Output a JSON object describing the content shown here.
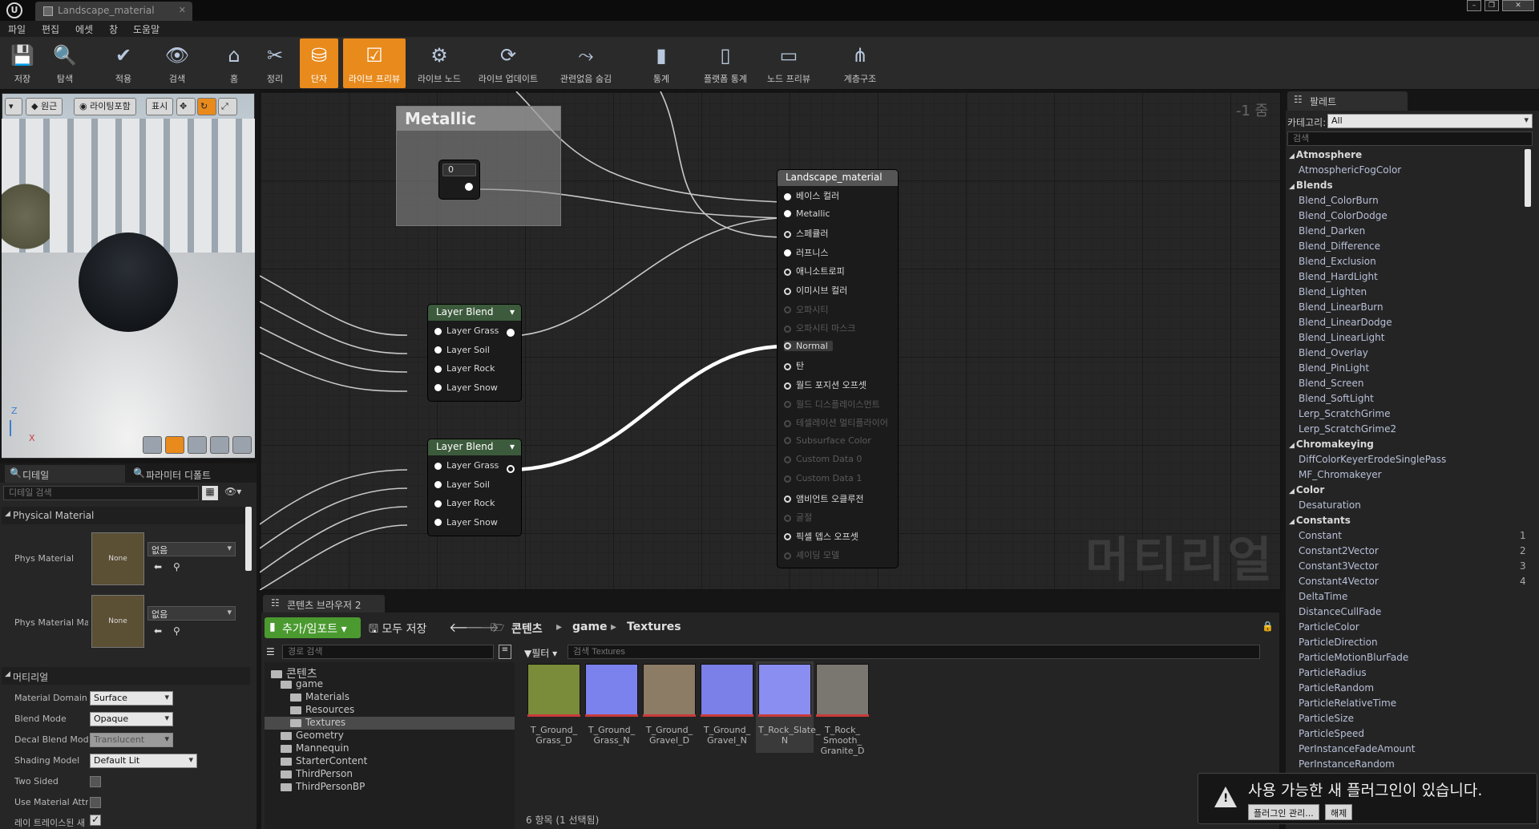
{
  "window": {
    "tab_title": "Landscape_material",
    "logo": "U"
  },
  "menu": [
    "파일",
    "편집",
    "에셋",
    "창",
    "도움말"
  ],
  "toolbar": [
    {
      "label": "저장",
      "icon": "💾"
    },
    {
      "label": "탐색",
      "icon": "🔍"
    },
    {
      "label": "적용",
      "icon": "✔"
    },
    {
      "label": "검색",
      "icon": "👁"
    },
    {
      "label": "홈",
      "icon": "⌂"
    },
    {
      "label": "정리",
      "icon": "✂"
    },
    {
      "label": "단자",
      "icon": "⛁"
    },
    {
      "label": "라이브 프리뷰",
      "icon": "☑"
    },
    {
      "label": "라이브 노드",
      "icon": "⚙"
    },
    {
      "label": "라이브 업데이트",
      "icon": "⟳"
    },
    {
      "label": "관련없음 숨김",
      "icon": "⤳"
    },
    {
      "label": "통계",
      "icon": "▮"
    },
    {
      "label": "플랫폼 통계",
      "icon": "▯"
    },
    {
      "label": "노드 프리뷰",
      "icon": "▭"
    },
    {
      "label": "계층구조",
      "icon": "⋔"
    }
  ],
  "viewport": {
    "btn_origin": "원근",
    "btn_lit": "라이팅포함",
    "btn_show": "표시",
    "axis_z": "Z",
    "axis_x": "X"
  },
  "details": {
    "tab1": "디테일",
    "tab2": "파라미터 디폴트",
    "search_placeholder": "디테일 검색",
    "section_physical": "Physical Material",
    "phys_material_label": "Phys Material",
    "phys_material_mask_label": "Phys Material Ma",
    "none": "None",
    "none_combo": "없음",
    "section_material": "머티리얼",
    "props": [
      {
        "label": "Material Domain",
        "value": "Surface"
      },
      {
        "label": "Blend Mode",
        "value": "Opaque"
      },
      {
        "label": "Decal Blend Mode",
        "value": "Translucent"
      },
      {
        "label": "Shading Model",
        "value": "Default Lit"
      }
    ],
    "two_sided": "Two Sided",
    "use_material_attr": "Use Material Attri",
    "ray_tracing": "레이 트레이스된 새"
  },
  "graph": {
    "zoom": "-1 줌",
    "watermark": "머티리얼",
    "metallic_node": {
      "title": "Metallic",
      "value": "0"
    },
    "layer_blend_1": {
      "title": "Layer Blend",
      "pins": [
        "Layer Grass",
        "Layer Soil",
        "Layer Rock",
        "Layer Snow"
      ]
    },
    "layer_blend_2": {
      "title": "Layer Blend",
      "pins": [
        "Layer Grass",
        "Layer Soil",
        "Layer Rock",
        "Layer Snow"
      ]
    },
    "material_node": {
      "title": "Landscape_material",
      "pins": [
        {
          "label": "베이스 컬러",
          "active": true
        },
        {
          "label": "Metallic",
          "active": true
        },
        {
          "label": "스페큘러",
          "active": true
        },
        {
          "label": "러프니스",
          "active": true
        },
        {
          "label": "애니소트로피",
          "active": true
        },
        {
          "label": "이미시브 컬러",
          "active": true
        },
        {
          "label": "오파시티",
          "active": false
        },
        {
          "label": "오파시티 마스크",
          "active": false
        },
        {
          "label": "Normal",
          "active": true
        },
        {
          "label": "탄",
          "active": true
        },
        {
          "label": "월드 포지션 오프셋",
          "active": true
        },
        {
          "label": "월드 디스플레이스먼트",
          "active": false
        },
        {
          "label": "테셀레이션 멀티플라이어",
          "active": false
        },
        {
          "label": "Subsurface Color",
          "active": false
        },
        {
          "label": "Custom Data 0",
          "active": false
        },
        {
          "label": "Custom Data 1",
          "active": false
        },
        {
          "label": "앰비언트 오클루전",
          "active": true
        },
        {
          "label": "굴절",
          "active": false
        },
        {
          "label": "픽셀 뎁스 오프셋",
          "active": true
        },
        {
          "label": "셰이딩 모델",
          "active": false
        }
      ]
    }
  },
  "content_browser": {
    "tab": "콘텐츠 브라우저 2",
    "add_import": "추가/임포트",
    "save_all": "모두 저장",
    "crumbs": [
      "콘텐츠",
      "game",
      "Textures"
    ],
    "path_search_placeholder": "경로 검색",
    "filter": "필터",
    "search_placeholder": "검색 Textures",
    "tree": [
      {
        "label": "콘텐츠",
        "indent": 0
      },
      {
        "label": "game",
        "indent": 1
      },
      {
        "label": "Materials",
        "indent": 2
      },
      {
        "label": "Resources",
        "indent": 2
      },
      {
        "label": "Textures",
        "indent": 2
      },
      {
        "label": "Geometry",
        "indent": 1
      },
      {
        "label": "Mannequin",
        "indent": 1
      },
      {
        "label": "StarterContent",
        "indent": 1
      },
      {
        "label": "ThirdPerson",
        "indent": 1
      },
      {
        "label": "ThirdPersonBP",
        "indent": 1
      }
    ],
    "assets": [
      {
        "label": "T_Ground_ Grass_D",
        "color": "#7a8c3a"
      },
      {
        "label": "T_Ground_ Grass_N",
        "color": "#7b82ee"
      },
      {
        "label": "T_Ground_ Gravel_D",
        "color": "#8c7c66"
      },
      {
        "label": "T_Ground_ Gravel_N",
        "color": "#7a80e8"
      },
      {
        "label": "T_Rock_Slate_ N",
        "color": "#8a8ef0"
      },
      {
        "label": "T_Rock_ Smooth_ Granite_D",
        "color": "#7a7670"
      }
    ],
    "status": "6 항목 (1 선택됨)"
  },
  "palette": {
    "tab": "팔레트",
    "category_label": "카테고리:",
    "category_value": "All",
    "search_placeholder": "검색",
    "rows": [
      {
        "t": "cat",
        "label": "Atmosphere"
      },
      {
        "t": "item",
        "label": "AtmosphericFogColor"
      },
      {
        "t": "cat",
        "label": "Blends"
      },
      {
        "t": "item",
        "label": "Blend_ColorBurn"
      },
      {
        "t": "item",
        "label": "Blend_ColorDodge"
      },
      {
        "t": "item",
        "label": "Blend_Darken"
      },
      {
        "t": "item",
        "label": "Blend_Difference"
      },
      {
        "t": "item",
        "label": "Blend_Exclusion"
      },
      {
        "t": "item",
        "label": "Blend_HardLight"
      },
      {
        "t": "item",
        "label": "Blend_Lighten"
      },
      {
        "t": "item",
        "label": "Blend_LinearBurn"
      },
      {
        "t": "item",
        "label": "Blend_LinearDodge"
      },
      {
        "t": "item",
        "label": "Blend_LinearLight"
      },
      {
        "t": "item",
        "label": "Blend_Overlay"
      },
      {
        "t": "item",
        "label": "Blend_PinLight"
      },
      {
        "t": "item",
        "label": "Blend_Screen"
      },
      {
        "t": "item",
        "label": "Blend_SoftLight"
      },
      {
        "t": "item",
        "label": "Lerp_ScratchGrime"
      },
      {
        "t": "item",
        "label": "Lerp_ScratchGrime2"
      },
      {
        "t": "cat",
        "label": "Chromakeying"
      },
      {
        "t": "item",
        "label": "DiffColorKeyerErodeSinglePass"
      },
      {
        "t": "item",
        "label": "MF_Chromakeyer"
      },
      {
        "t": "cat",
        "label": "Color"
      },
      {
        "t": "item",
        "label": "Desaturation"
      },
      {
        "t": "cat",
        "label": "Constants"
      },
      {
        "t": "item",
        "label": "Constant",
        "num": "1"
      },
      {
        "t": "item",
        "label": "Constant2Vector",
        "num": "2"
      },
      {
        "t": "item",
        "label": "Constant3Vector",
        "num": "3"
      },
      {
        "t": "item",
        "label": "Constant4Vector",
        "num": "4"
      },
      {
        "t": "item",
        "label": "DeltaTime"
      },
      {
        "t": "item",
        "label": "DistanceCullFade"
      },
      {
        "t": "item",
        "label": "ParticleColor"
      },
      {
        "t": "item",
        "label": "ParticleDirection"
      },
      {
        "t": "item",
        "label": "ParticleMotionBlurFade"
      },
      {
        "t": "item",
        "label": "ParticleRadius"
      },
      {
        "t": "item",
        "label": "ParticleRandom"
      },
      {
        "t": "item",
        "label": "ParticleRelativeTime"
      },
      {
        "t": "item",
        "label": "ParticleSize"
      },
      {
        "t": "item",
        "label": "ParticleSpeed"
      },
      {
        "t": "item",
        "label": "PerInstanceFadeAmount"
      },
      {
        "t": "item",
        "label": "PerInstanceRandom"
      }
    ]
  },
  "notification": {
    "text": "사용 가능한 새 플러그인이 있습니다.",
    "manage": "플러그인 관리...",
    "dismiss": "해제"
  }
}
